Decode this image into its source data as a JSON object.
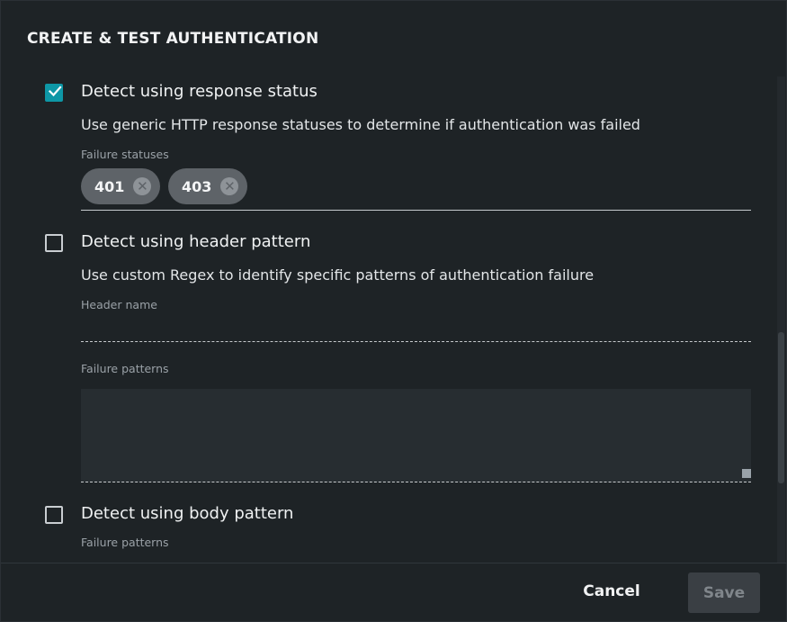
{
  "dialog": {
    "title": "CREATE & TEST AUTHENTICATION"
  },
  "response_status": {
    "checked": true,
    "label": "Detect using response status",
    "description": "Use generic HTTP response statuses to determine if authentication was failed",
    "field_label": "Failure statuses",
    "chips": [
      "401",
      "403"
    ]
  },
  "header_pattern": {
    "checked": false,
    "label": "Detect using header pattern",
    "description": "Use custom Regex to identify specific patterns of authentication failure",
    "header_name_label": "Header name",
    "header_name_value": "",
    "patterns_label": "Failure patterns",
    "patterns_value": ""
  },
  "body_pattern": {
    "checked": false,
    "label": "Detect using body pattern",
    "patterns_label": "Failure patterns"
  },
  "footer": {
    "cancel_label": "Cancel",
    "save_label": "Save"
  },
  "colors": {
    "accent": "#0e97a6",
    "background": "#1e2326",
    "chip": "#5e6368"
  },
  "icons": {
    "check": "checkmark-icon",
    "chip_remove": "close-circle-icon"
  }
}
